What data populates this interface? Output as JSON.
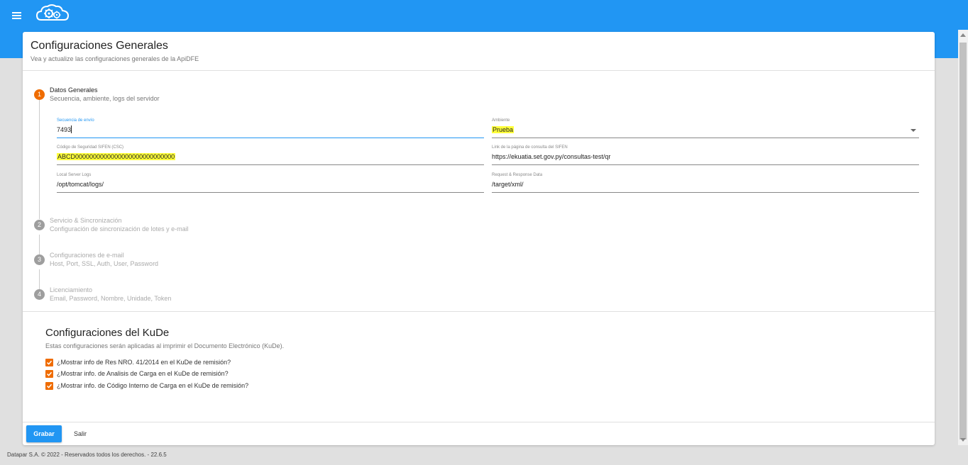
{
  "header": {
    "menu_icon": "hamburger-menu-icon",
    "logo_icon": "cloud-gears-logo-icon",
    "brand_color": "#2196f3"
  },
  "page": {
    "title": "Configuraciones Generales",
    "subtitle": "Vea y actualize las configuraciones generales de la ApiDFE"
  },
  "steps": [
    {
      "number": "1",
      "title": "Datos Generales",
      "subtitle": "Secuencia, ambiente, logs del servidor",
      "active": true
    },
    {
      "number": "2",
      "title": "Servicio & Sincronización",
      "subtitle": "Configuración de sincronización de lotes y e-mail",
      "active": false
    },
    {
      "number": "3",
      "title": "Configuraciones de e-mail",
      "subtitle": "Host, Port, SSL, Auth, User, Password",
      "active": false
    },
    {
      "number": "4",
      "title": "Licenciamiento",
      "subtitle": "Email, Password, Nombre, Unidade, Token",
      "active": false
    }
  ],
  "fields": {
    "secuencia": {
      "label": "Secuencia de envío",
      "value": "7493"
    },
    "ambiente": {
      "label": "Ambiente",
      "value": "Prueba"
    },
    "csc": {
      "label": "Código de Seguridad SIFEN (CSC)",
      "value": "ABCD0000000000000000000000000000"
    },
    "link": {
      "label": "Link de la página de consulta del SIFEN",
      "value": "https://ekuatia.set.gov.py/consultas-test/qr"
    },
    "logs": {
      "label": "Local Server Logs",
      "value": "/opt/tomcat/logs/"
    },
    "request": {
      "label": "Request & Response Data",
      "value": "/target/xml/"
    }
  },
  "kude": {
    "title": "Configuraciones del KuDe",
    "subtitle": "Estas configuraciones serán aplicadas al imprimir el Documento Electrónico (KuDe).",
    "options": [
      {
        "label": "¿Mostrar info de Res NRO. 41/2014 en el KuDe de remisión?",
        "checked": true
      },
      {
        "label": "¿Mostrar info. de Analisis de Carga en el KuDe de remisión?",
        "checked": true
      },
      {
        "label": "¿Mostrar info. de Código Interno de Carga en el KuDe de remisión?",
        "checked": true
      }
    ]
  },
  "actions": {
    "save_label": "Grabar",
    "exit_label": "Salir"
  },
  "footer": {
    "text": "Datapar S.A. © 2022 - Reservados todos los derechos. - 22.6.5"
  },
  "colors": {
    "accent": "#2196f3",
    "step_active": "#ef6c00",
    "highlight": "#ffff3a"
  }
}
